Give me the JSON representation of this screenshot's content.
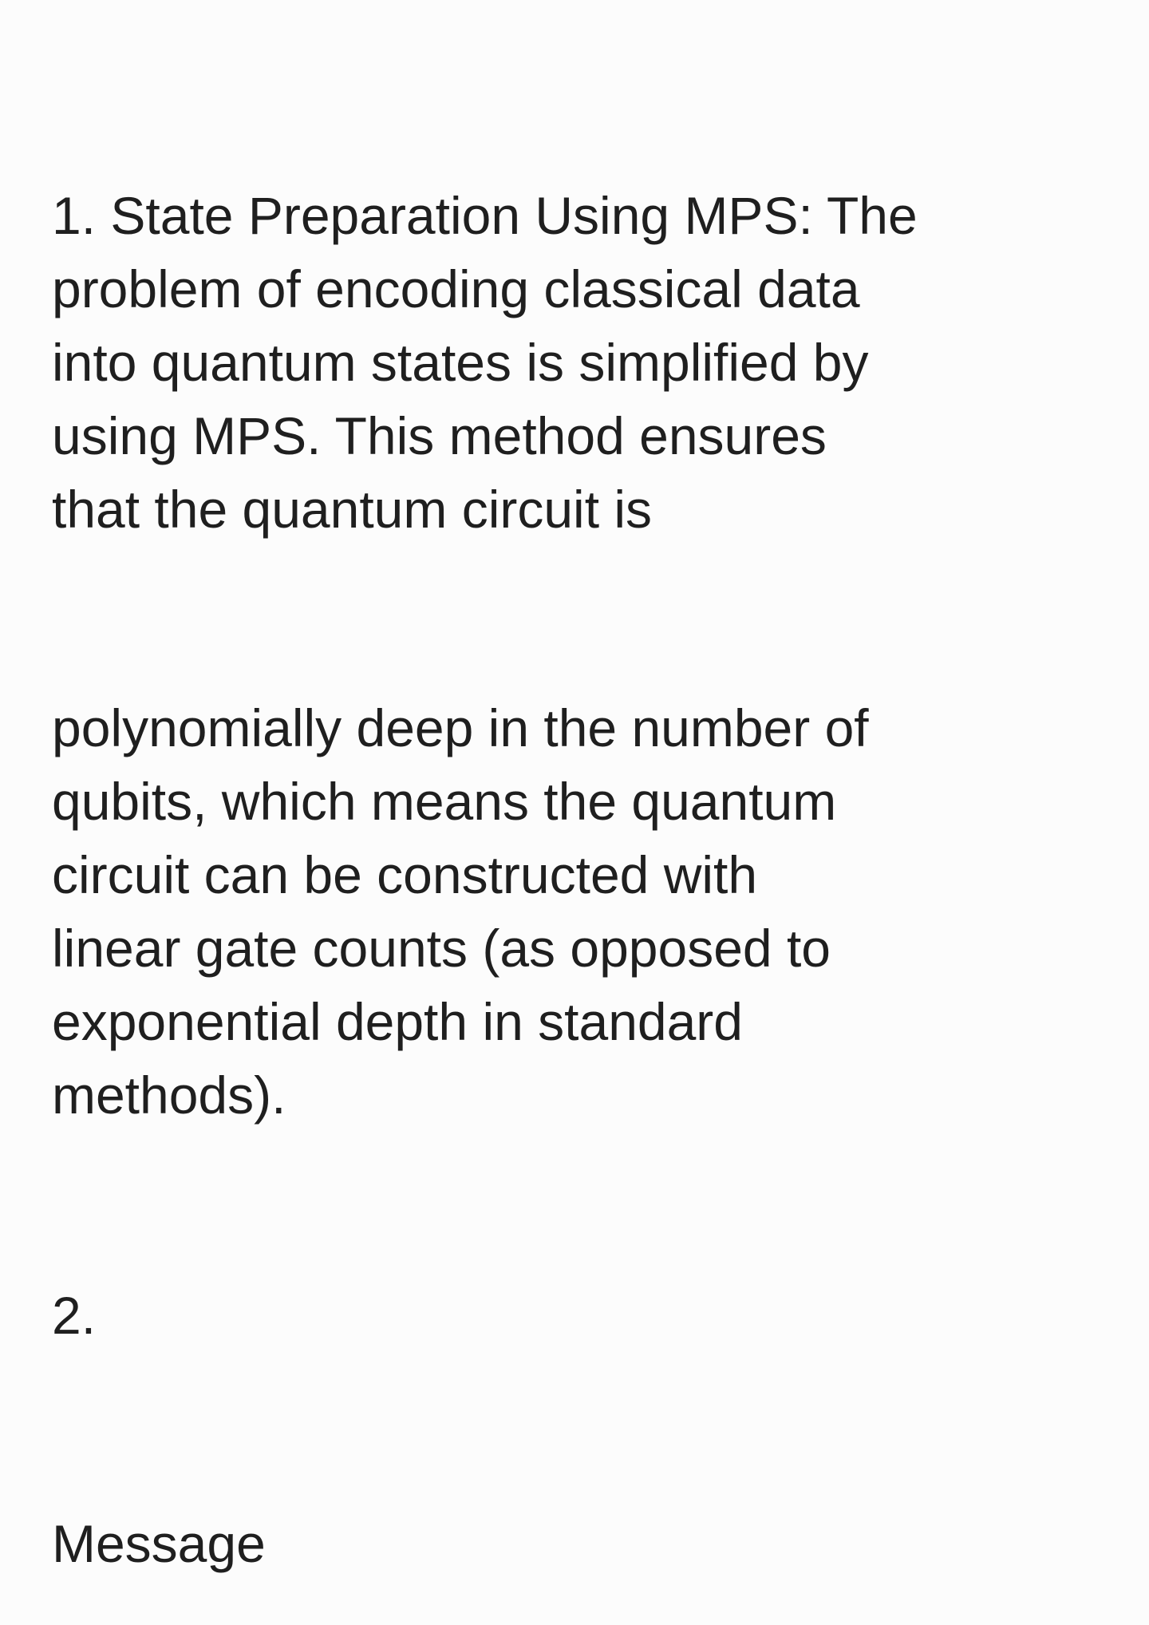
{
  "conversation": {
    "paragraphs": [
      "1. State Preparation Using MPS: The\nproblem of encoding classical data\ninto quantum states is simplified by\nusing MPS. This method ensures\nthat the quantum circuit is",
      "polynomially deep in the number of\nqubits, which means the quantum\ncircuit can be constructed with\nlinear gate counts (as opposed to\nexponential depth in standard\nmethods).",
      "2."
    ]
  },
  "composer": {
    "placeholder": "Message",
    "value": ""
  }
}
